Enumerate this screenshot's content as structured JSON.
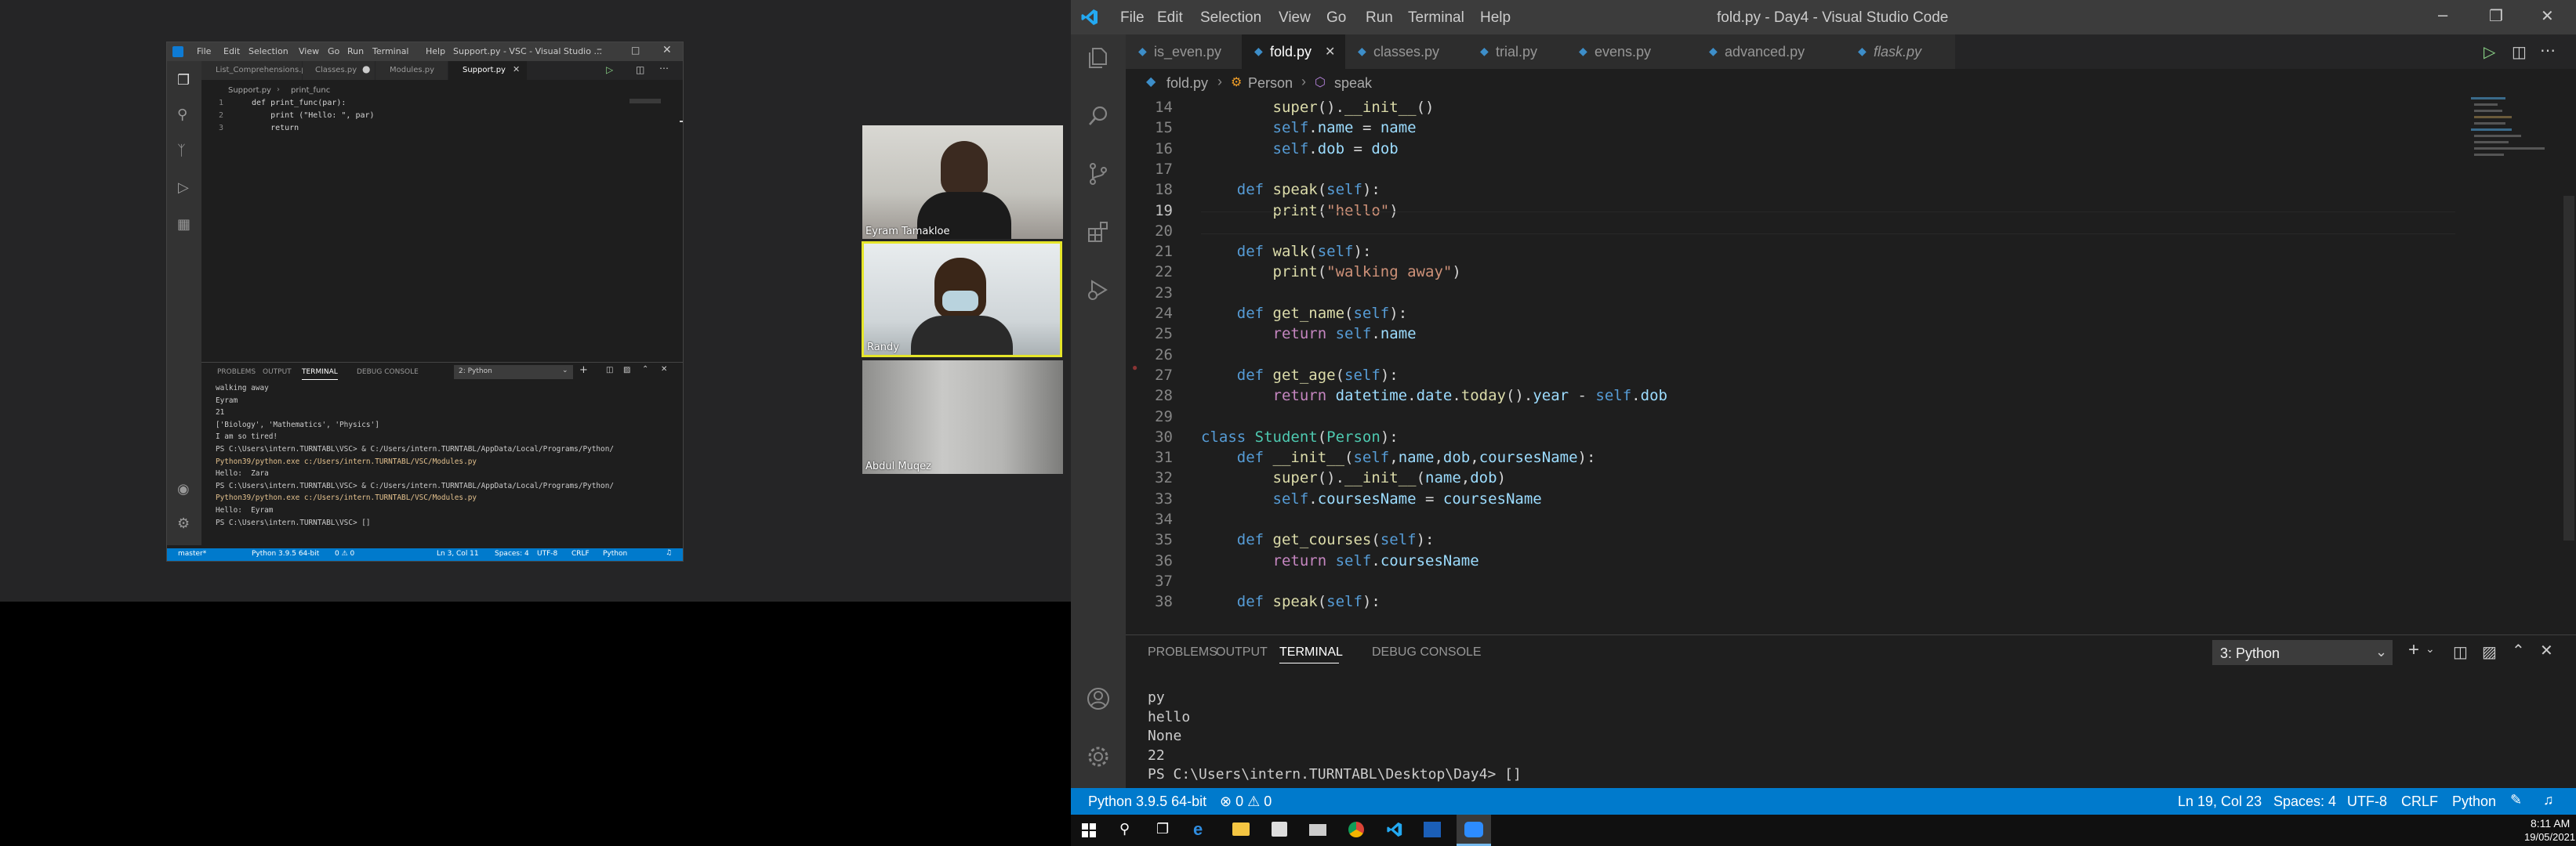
{
  "left": {
    "menu": [
      "File",
      "Edit",
      "Selection",
      "View",
      "Go",
      "Run",
      "Terminal",
      "Help"
    ],
    "title": "Support.py - VSC - Visual Studio ...",
    "tabs": [
      "List_Comprehensions.py",
      "Classes.py",
      "Modules.py",
      "Support.py"
    ],
    "breadcrumb": [
      "Support.py",
      "print_func"
    ],
    "code_lines": [
      {
        "n": "1",
        "text": "def print_func(par):"
      },
      {
        "n": "2",
        "text": "    print (\"Hello: \", par)"
      },
      {
        "n": "3",
        "text": "    return"
      }
    ],
    "panel_tabs": [
      "PROBLEMS",
      "OUTPUT",
      "TERMINAL",
      "DEBUG CONSOLE"
    ],
    "terminal_select": "2: Python",
    "terminal_lines": [
      "walking away",
      "Eyram",
      "21",
      "['Biology', 'Mathematics', 'Physics']",
      "I am so tired!",
      "PS C:\\Users\\intern.TURNTABL\\VSC> & C:/Users/intern.TURNTABL/AppData/Local/Programs/Python/",
      "Python39/python.exe c:/Users/intern.TURNTABL/VSC/Modules.py",
      "Hello:  Zara",
      "PS C:\\Users\\intern.TURNTABL\\VSC> & C:/Users/intern.TURNTABL/AppData/Local/Programs/Python/",
      "Python39/python.exe c:/Users/intern.TURNTABL/VSC/Modules.py",
      "Hello:  Eyram",
      "PS C:\\Users\\intern.TURNTABL\\VSC> []"
    ],
    "status": {
      "branch": "master*",
      "python": "Python 3.9.5 64-bit",
      "errors": "0 ⚠ 0",
      "position": "Ln 3, Col 11",
      "spaces": "Spaces: 4",
      "encoding": "UTF-8",
      "eol": "CRLF",
      "lang": "Python"
    }
  },
  "participants": [
    "Eyram Tamakloe",
    "Randy",
    "Abdul Muqez"
  ],
  "window": {
    "menu": [
      "File",
      "Edit",
      "Selection",
      "View",
      "Go",
      "Run",
      "Terminal",
      "Help"
    ],
    "title": "fold.py - Day4 - Visual Studio Code"
  },
  "tabs": [
    "is_even.py",
    "fold.py",
    "classes.py",
    "trial.py",
    "evens.py",
    "advanced.py",
    "flask.py"
  ],
  "breadcrumb": [
    "fold.py",
    "Person",
    "speak"
  ],
  "code": [
    {
      "n": "14",
      "tokens": [
        {
          "c": "fn",
          "t": "        super"
        },
        {
          "c": "tx",
          "t": "()."
        },
        {
          "c": "fn",
          "t": "__init__"
        },
        {
          "c": "tx",
          "t": "()"
        }
      ]
    },
    {
      "n": "15",
      "tokens": [
        {
          "c": "kb",
          "t": "        self"
        },
        {
          "c": "tx",
          "t": "."
        },
        {
          "c": "vr",
          "t": "name"
        },
        {
          "c": "tx",
          "t": " = "
        },
        {
          "c": "vr",
          "t": "name"
        }
      ]
    },
    {
      "n": "16",
      "tokens": [
        {
          "c": "kb",
          "t": "        self"
        },
        {
          "c": "tx",
          "t": "."
        },
        {
          "c": "vr",
          "t": "dob"
        },
        {
          "c": "tx",
          "t": " = "
        },
        {
          "c": "vr",
          "t": "dob"
        }
      ]
    },
    {
      "n": "17",
      "tokens": []
    },
    {
      "n": "18",
      "tokens": [
        {
          "c": "kb",
          "t": "    def "
        },
        {
          "c": "fn",
          "t": "speak"
        },
        {
          "c": "tx",
          "t": "("
        },
        {
          "c": "kb",
          "t": "self"
        },
        {
          "c": "tx",
          "t": "):"
        }
      ]
    },
    {
      "n": "19",
      "tokens": [
        {
          "c": "fn",
          "t": "        print"
        },
        {
          "c": "tx",
          "t": "("
        },
        {
          "c": "st",
          "t": "\"hello\""
        },
        {
          "c": "tx",
          "t": ")"
        }
      ]
    },
    {
      "n": "20",
      "tokens": []
    },
    {
      "n": "21",
      "tokens": [
        {
          "c": "kb",
          "t": "    def "
        },
        {
          "c": "fn",
          "t": "walk"
        },
        {
          "c": "tx",
          "t": "("
        },
        {
          "c": "kb",
          "t": "self"
        },
        {
          "c": "tx",
          "t": "):"
        }
      ]
    },
    {
      "n": "22",
      "tokens": [
        {
          "c": "fn",
          "t": "        print"
        },
        {
          "c": "tx",
          "t": "("
        },
        {
          "c": "st",
          "t": "\"walking away\""
        },
        {
          "c": "tx",
          "t": ")"
        }
      ]
    },
    {
      "n": "23",
      "tokens": []
    },
    {
      "n": "24",
      "tokens": [
        {
          "c": "kb",
          "t": "    def "
        },
        {
          "c": "fn",
          "t": "get_name"
        },
        {
          "c": "tx",
          "t": "("
        },
        {
          "c": "kb",
          "t": "self"
        },
        {
          "c": "tx",
          "t": "):"
        }
      ]
    },
    {
      "n": "25",
      "tokens": [
        {
          "c": "kw",
          "t": "        return "
        },
        {
          "c": "kb",
          "t": "self"
        },
        {
          "c": "tx",
          "t": "."
        },
        {
          "c": "vr",
          "t": "name"
        }
      ]
    },
    {
      "n": "26",
      "tokens": []
    },
    {
      "n": "27",
      "tokens": [
        {
          "c": "kb",
          "t": "    def "
        },
        {
          "c": "fn",
          "t": "get_age"
        },
        {
          "c": "tx",
          "t": "("
        },
        {
          "c": "kb",
          "t": "self"
        },
        {
          "c": "tx",
          "t": "):"
        }
      ]
    },
    {
      "n": "28",
      "tokens": [
        {
          "c": "kw",
          "t": "        return "
        },
        {
          "c": "vr",
          "t": "datetime"
        },
        {
          "c": "tx",
          "t": "."
        },
        {
          "c": "vr",
          "t": "date"
        },
        {
          "c": "tx",
          "t": "."
        },
        {
          "c": "fn",
          "t": "today"
        },
        {
          "c": "tx",
          "t": "()."
        },
        {
          "c": "vr",
          "t": "year"
        },
        {
          "c": "tx",
          "t": " - "
        },
        {
          "c": "kb",
          "t": "self"
        },
        {
          "c": "tx",
          "t": "."
        },
        {
          "c": "vr",
          "t": "dob"
        }
      ]
    },
    {
      "n": "29",
      "tokens": []
    },
    {
      "n": "30",
      "tokens": [
        {
          "c": "kb",
          "t": "class "
        },
        {
          "c": "cl",
          "t": "Student"
        },
        {
          "c": "tx",
          "t": "("
        },
        {
          "c": "cl",
          "t": "Person"
        },
        {
          "c": "tx",
          "t": "):"
        }
      ]
    },
    {
      "n": "31",
      "tokens": [
        {
          "c": "kb",
          "t": "    def "
        },
        {
          "c": "fn",
          "t": "__init__"
        },
        {
          "c": "tx",
          "t": "("
        },
        {
          "c": "kb",
          "t": "self"
        },
        {
          "c": "tx",
          "t": ","
        },
        {
          "c": "vr",
          "t": "name"
        },
        {
          "c": "tx",
          "t": ","
        },
        {
          "c": "vr",
          "t": "dob"
        },
        {
          "c": "tx",
          "t": ","
        },
        {
          "c": "vr",
          "t": "coursesName"
        },
        {
          "c": "tx",
          "t": "):"
        }
      ]
    },
    {
      "n": "32",
      "tokens": [
        {
          "c": "fn",
          "t": "        super"
        },
        {
          "c": "tx",
          "t": "()."
        },
        {
          "c": "fn",
          "t": "__init__"
        },
        {
          "c": "tx",
          "t": "("
        },
        {
          "c": "vr",
          "t": "name"
        },
        {
          "c": "tx",
          "t": ","
        },
        {
          "c": "vr",
          "t": "dob"
        },
        {
          "c": "tx",
          "t": ")"
        }
      ]
    },
    {
      "n": "33",
      "tokens": [
        {
          "c": "kb",
          "t": "        self"
        },
        {
          "c": "tx",
          "t": "."
        },
        {
          "c": "vr",
          "t": "coursesName"
        },
        {
          "c": "tx",
          "t": " = "
        },
        {
          "c": "vr",
          "t": "coursesName"
        }
      ]
    },
    {
      "n": "34",
      "tokens": []
    },
    {
      "n": "35",
      "tokens": [
        {
          "c": "kb",
          "t": "    def "
        },
        {
          "c": "fn",
          "t": "get_courses"
        },
        {
          "c": "tx",
          "t": "("
        },
        {
          "c": "kb",
          "t": "self"
        },
        {
          "c": "tx",
          "t": "):"
        }
      ]
    },
    {
      "n": "36",
      "tokens": [
        {
          "c": "kw",
          "t": "        return "
        },
        {
          "c": "kb",
          "t": "self"
        },
        {
          "c": "tx",
          "t": "."
        },
        {
          "c": "vr",
          "t": "coursesName"
        }
      ]
    },
    {
      "n": "37",
      "tokens": []
    },
    {
      "n": "38",
      "tokens": [
        {
          "c": "kb",
          "t": "    def "
        },
        {
          "c": "fn",
          "t": "speak"
        },
        {
          "c": "tx",
          "t": "("
        },
        {
          "c": "kb",
          "t": "self"
        },
        {
          "c": "tx",
          "t": "):"
        }
      ]
    }
  ],
  "panel": {
    "tabs": [
      "PROBLEMS",
      "OUTPUT",
      "TERMINAL",
      "DEBUG CONSOLE"
    ],
    "terminal_select": "3: Python",
    "lines": [
      "py",
      "hello",
      "None",
      "22",
      "PS C:\\Users\\intern.TURNTABL\\Desktop\\Day4> []"
    ]
  },
  "statusbar": {
    "python": "Python 3.9.5 64-bit",
    "errors": "⊗ 0 ⚠ 0",
    "position": "Ln 19, Col 23",
    "spaces": "Spaces: 4",
    "encoding": "UTF-8",
    "eol": "CRLF",
    "lang": "Python"
  },
  "taskbar": {
    "time": "8:11 AM",
    "date": "19/05/2021"
  },
  "colors": {
    "statusbar": "#007acc",
    "activity": "#333333",
    "tabbar": "#252526",
    "editor": "#1e1e1e",
    "taskbar": "#101010"
  }
}
